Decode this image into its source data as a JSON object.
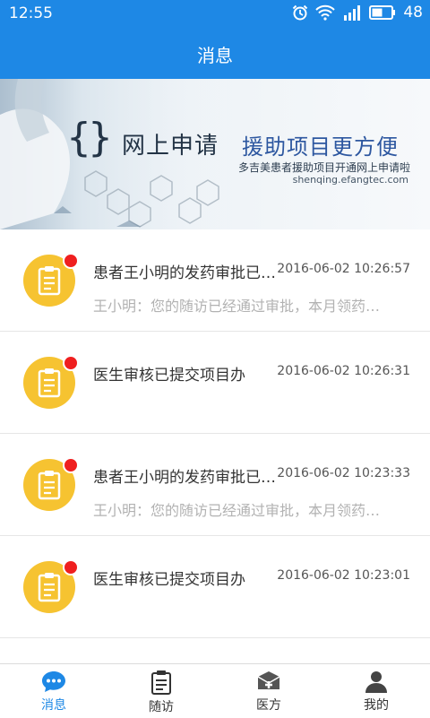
{
  "status": {
    "time": "12:55",
    "battery": "48"
  },
  "header": {
    "title": "消息"
  },
  "banner": {
    "title_part1": "网上申请",
    "title_part2": "援助项目更方便",
    "subtitle": "多吉美患者援助项目开通网上申请啦",
    "url": "shenqing.efangtec.com"
  },
  "messages": [
    {
      "title": "患者王小明的发药审批已通过",
      "time": "2016-06-02 10:26:57",
      "preview": "王小明：您的随访已经通过审批，本月领药请及时"
    },
    {
      "title": "医生审核已提交项目办",
      "time": "2016-06-02 10:26:31",
      "preview": ""
    },
    {
      "title": "患者王小明的发药审批已通过",
      "time": "2016-06-02 10:23:33",
      "preview": "王小明：您的随访已经通过审批，本月领药请及时"
    },
    {
      "title": "医生审核已提交项目办",
      "time": "2016-06-02 10:23:01",
      "preview": ""
    }
  ],
  "tabs": [
    {
      "label": "消息",
      "icon": "chat-bubble-icon",
      "active": true
    },
    {
      "label": "随访",
      "icon": "clipboard-icon",
      "active": false
    },
    {
      "label": "医方",
      "icon": "medical-kit-icon",
      "active": false
    },
    {
      "label": "我的",
      "icon": "person-icon",
      "active": false
    }
  ],
  "colors": {
    "primary": "#1e88e5",
    "badge": "#ef1f1f",
    "avatar": "#f6c331"
  }
}
